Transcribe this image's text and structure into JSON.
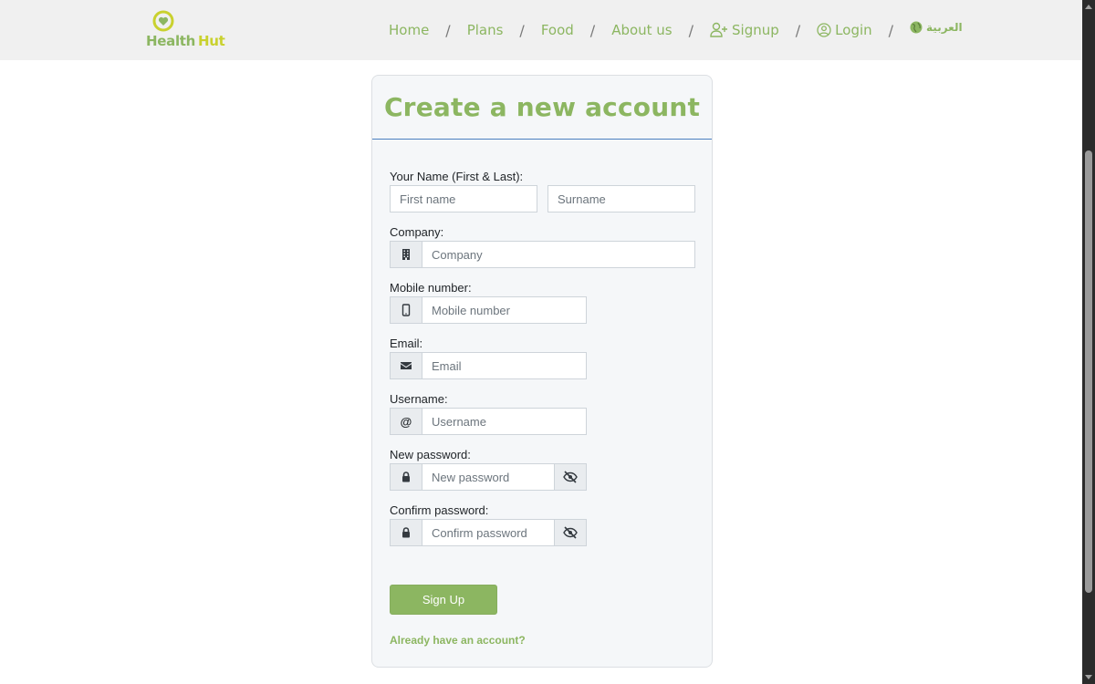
{
  "brand": {
    "name_part1": "Health",
    "name_part2": "Hut",
    "primary_color": "#8cb661",
    "accent_color": "#c9d12e"
  },
  "nav": {
    "home": "Home",
    "plans": "Plans",
    "food": "Food",
    "about": "About us",
    "signup": "Signup",
    "login": "Login",
    "language": "العربية",
    "separator": "/"
  },
  "form": {
    "title": "Create a new account",
    "name_label": "Your Name (First & Last):",
    "first_name_placeholder": "First name",
    "surname_placeholder": "Surname",
    "company_label": "Company:",
    "company_placeholder": "Company",
    "mobile_label": "Mobile number:",
    "mobile_placeholder": "Mobile number",
    "email_label": "Email:",
    "email_placeholder": "Email",
    "username_label": "Username:",
    "username_addon": "@",
    "username_placeholder": "Username",
    "new_password_label": "New password:",
    "new_password_placeholder": "New password",
    "confirm_password_label": "Confirm password:",
    "confirm_password_placeholder": "Confirm password",
    "submit_label": "Sign Up",
    "login_link": "Already have an account?"
  },
  "icons": {
    "company": "building-icon",
    "mobile": "mobile-phone-icon",
    "email": "envelope-icon",
    "password": "lock-icon",
    "toggle_visibility": "eye-slash-icon",
    "signup": "user-plus-icon",
    "login": "user-circle-icon",
    "language": "globe-icon"
  }
}
